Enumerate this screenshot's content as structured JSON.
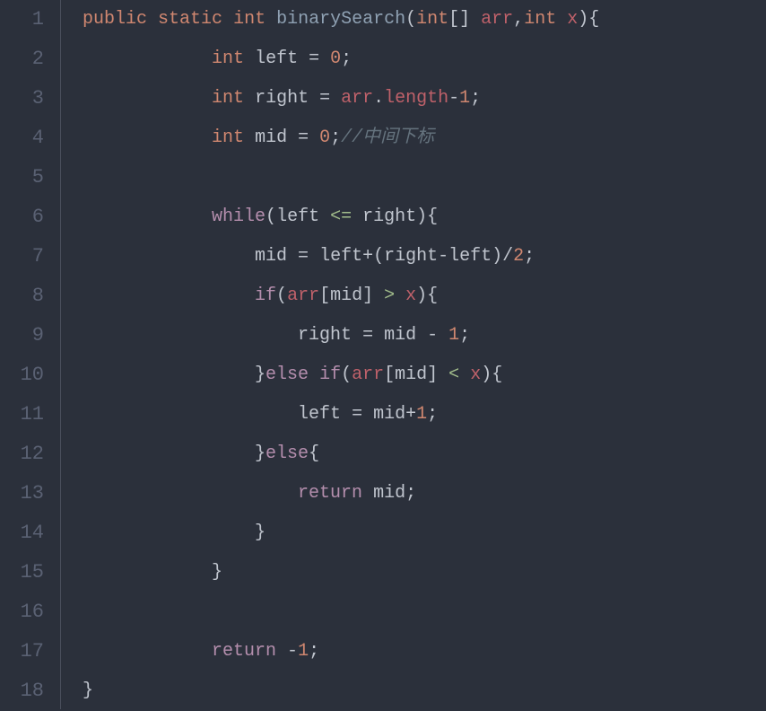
{
  "editor": {
    "lineNumbers": [
      "1",
      "2",
      "3",
      "4",
      "5",
      "6",
      "7",
      "8",
      "9",
      "10",
      "11",
      "12",
      "13",
      "14",
      "15",
      "16",
      "17",
      "18"
    ]
  },
  "code": {
    "tokens": [
      [
        {
          "t": "public",
          "c": "kw-mod"
        },
        {
          "t": " ",
          "c": "op"
        },
        {
          "t": "static",
          "c": "kw-mod"
        },
        {
          "t": " ",
          "c": "op"
        },
        {
          "t": "int",
          "c": "kw-type"
        },
        {
          "t": " ",
          "c": "op"
        },
        {
          "t": "binarySearch",
          "c": "fn"
        },
        {
          "t": "(",
          "c": "punct"
        },
        {
          "t": "int",
          "c": "kw-type"
        },
        {
          "t": "[] ",
          "c": "punct"
        },
        {
          "t": "arr",
          "c": "param"
        },
        {
          "t": ",",
          "c": "punct"
        },
        {
          "t": "int",
          "c": "kw-type"
        },
        {
          "t": " ",
          "c": "op"
        },
        {
          "t": "x",
          "c": "param"
        },
        {
          "t": "){",
          "c": "punct"
        }
      ],
      [
        {
          "t": "            ",
          "c": "op"
        },
        {
          "t": "int",
          "c": "kw-type"
        },
        {
          "t": " ",
          "c": "op"
        },
        {
          "t": "left",
          "c": "var"
        },
        {
          "t": " = ",
          "c": "op"
        },
        {
          "t": "0",
          "c": "num"
        },
        {
          "t": ";",
          "c": "punct"
        }
      ],
      [
        {
          "t": "            ",
          "c": "op"
        },
        {
          "t": "int",
          "c": "kw-type"
        },
        {
          "t": " ",
          "c": "op"
        },
        {
          "t": "right",
          "c": "var"
        },
        {
          "t": " = ",
          "c": "op"
        },
        {
          "t": "arr",
          "c": "param"
        },
        {
          "t": ".",
          "c": "punct"
        },
        {
          "t": "length",
          "c": "prop"
        },
        {
          "t": "-",
          "c": "op"
        },
        {
          "t": "1",
          "c": "num"
        },
        {
          "t": ";",
          "c": "punct"
        }
      ],
      [
        {
          "t": "            ",
          "c": "op"
        },
        {
          "t": "int",
          "c": "kw-type"
        },
        {
          "t": " ",
          "c": "op"
        },
        {
          "t": "mid",
          "c": "var"
        },
        {
          "t": " = ",
          "c": "op"
        },
        {
          "t": "0",
          "c": "num"
        },
        {
          "t": ";",
          "c": "punct"
        },
        {
          "t": "//中间下标",
          "c": "comment"
        }
      ],
      [],
      [
        {
          "t": "            ",
          "c": "op"
        },
        {
          "t": "while",
          "c": "kw-ctrl"
        },
        {
          "t": "(",
          "c": "punct"
        },
        {
          "t": "left",
          "c": "var"
        },
        {
          "t": " ",
          "c": "op"
        },
        {
          "t": "<=",
          "c": "cmp"
        },
        {
          "t": " ",
          "c": "op"
        },
        {
          "t": "right",
          "c": "var"
        },
        {
          "t": "){",
          "c": "punct"
        }
      ],
      [
        {
          "t": "                ",
          "c": "op"
        },
        {
          "t": "mid",
          "c": "var"
        },
        {
          "t": " = ",
          "c": "op"
        },
        {
          "t": "left",
          "c": "var"
        },
        {
          "t": "+(",
          "c": "punct"
        },
        {
          "t": "right",
          "c": "var"
        },
        {
          "t": "-",
          "c": "op"
        },
        {
          "t": "left",
          "c": "var"
        },
        {
          "t": ")/",
          "c": "punct"
        },
        {
          "t": "2",
          "c": "num"
        },
        {
          "t": ";",
          "c": "punct"
        }
      ],
      [
        {
          "t": "                ",
          "c": "op"
        },
        {
          "t": "if",
          "c": "kw-ctrl"
        },
        {
          "t": "(",
          "c": "punct"
        },
        {
          "t": "arr",
          "c": "param"
        },
        {
          "t": "[",
          "c": "punct"
        },
        {
          "t": "mid",
          "c": "var"
        },
        {
          "t": "] ",
          "c": "punct"
        },
        {
          "t": ">",
          "c": "cmp"
        },
        {
          "t": " ",
          "c": "op"
        },
        {
          "t": "x",
          "c": "param"
        },
        {
          "t": "){",
          "c": "punct"
        }
      ],
      [
        {
          "t": "                    ",
          "c": "op"
        },
        {
          "t": "right",
          "c": "var"
        },
        {
          "t": " = ",
          "c": "op"
        },
        {
          "t": "mid",
          "c": "var"
        },
        {
          "t": " - ",
          "c": "op"
        },
        {
          "t": "1",
          "c": "num"
        },
        {
          "t": ";",
          "c": "punct"
        }
      ],
      [
        {
          "t": "                }",
          "c": "punct"
        },
        {
          "t": "else",
          "c": "kw-ctrl"
        },
        {
          "t": " ",
          "c": "op"
        },
        {
          "t": "if",
          "c": "kw-ctrl"
        },
        {
          "t": "(",
          "c": "punct"
        },
        {
          "t": "arr",
          "c": "param"
        },
        {
          "t": "[",
          "c": "punct"
        },
        {
          "t": "mid",
          "c": "var"
        },
        {
          "t": "] ",
          "c": "punct"
        },
        {
          "t": "<",
          "c": "cmp"
        },
        {
          "t": " ",
          "c": "op"
        },
        {
          "t": "x",
          "c": "param"
        },
        {
          "t": "){",
          "c": "punct"
        }
      ],
      [
        {
          "t": "                    ",
          "c": "op"
        },
        {
          "t": "left",
          "c": "var"
        },
        {
          "t": " = ",
          "c": "op"
        },
        {
          "t": "mid",
          "c": "var"
        },
        {
          "t": "+",
          "c": "op"
        },
        {
          "t": "1",
          "c": "num"
        },
        {
          "t": ";",
          "c": "punct"
        }
      ],
      [
        {
          "t": "                }",
          "c": "punct"
        },
        {
          "t": "else",
          "c": "kw-ctrl"
        },
        {
          "t": "{",
          "c": "punct"
        }
      ],
      [
        {
          "t": "                    ",
          "c": "op"
        },
        {
          "t": "return",
          "c": "kw-ctrl"
        },
        {
          "t": " ",
          "c": "op"
        },
        {
          "t": "mid",
          "c": "var"
        },
        {
          "t": ";",
          "c": "punct"
        }
      ],
      [
        {
          "t": "                }",
          "c": "punct"
        }
      ],
      [
        {
          "t": "            }",
          "c": "punct"
        }
      ],
      [],
      [
        {
          "t": "            ",
          "c": "op"
        },
        {
          "t": "return",
          "c": "kw-ctrl"
        },
        {
          "t": " -",
          "c": "op"
        },
        {
          "t": "1",
          "c": "num"
        },
        {
          "t": ";",
          "c": "punct"
        }
      ],
      [
        {
          "t": "}",
          "c": "punct"
        }
      ]
    ]
  }
}
